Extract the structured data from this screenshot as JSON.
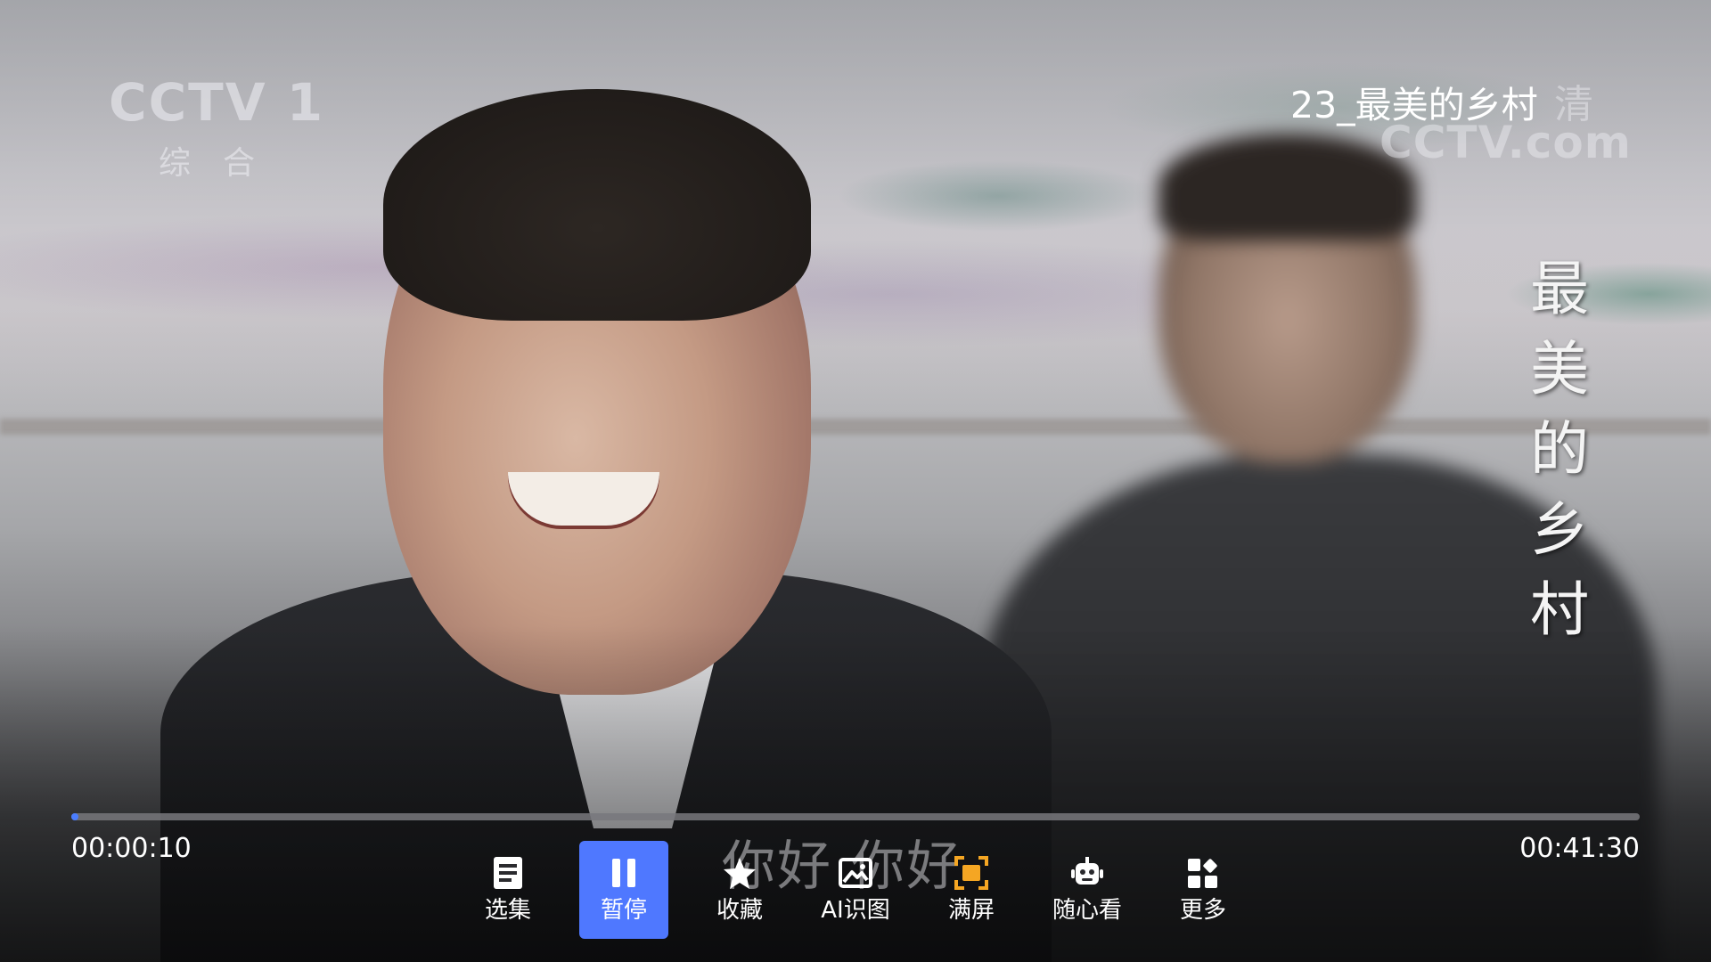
{
  "video": {
    "channel_logo": "CCTV 1",
    "channel_sub": "综合",
    "episode_title": "23_最美的乡村",
    "hd_mark": "清",
    "site_watermark": "CCTV.com",
    "vertical_title": [
      "最",
      "美",
      "的",
      "乡",
      "村"
    ],
    "subtitle": "你好 你好"
  },
  "playback": {
    "current_time": "00:00:10",
    "total_time": "00:41:30",
    "progress_fraction": 0.004,
    "progress_color": "#4a7dff"
  },
  "controls": [
    {
      "key": "episodes",
      "label": "选集",
      "icon": "list-icon",
      "active": false
    },
    {
      "key": "pause",
      "label": "暂停",
      "icon": "pause-icon",
      "active": true
    },
    {
      "key": "favorite",
      "label": "收藏",
      "icon": "star-icon",
      "active": false
    },
    {
      "key": "ai-recognize",
      "label": "AI识图",
      "icon": "image-icon",
      "active": false
    },
    {
      "key": "fullscreen",
      "label": "满屏",
      "icon": "fullscreen-icon",
      "active": false
    },
    {
      "key": "random-watch",
      "label": "随心看",
      "icon": "robot-icon",
      "active": false
    },
    {
      "key": "more",
      "label": "更多",
      "icon": "grid-icon",
      "active": false
    }
  ],
  "colors": {
    "active_button": "#4f78ff",
    "fullscreen_icon": "#f5a623"
  }
}
